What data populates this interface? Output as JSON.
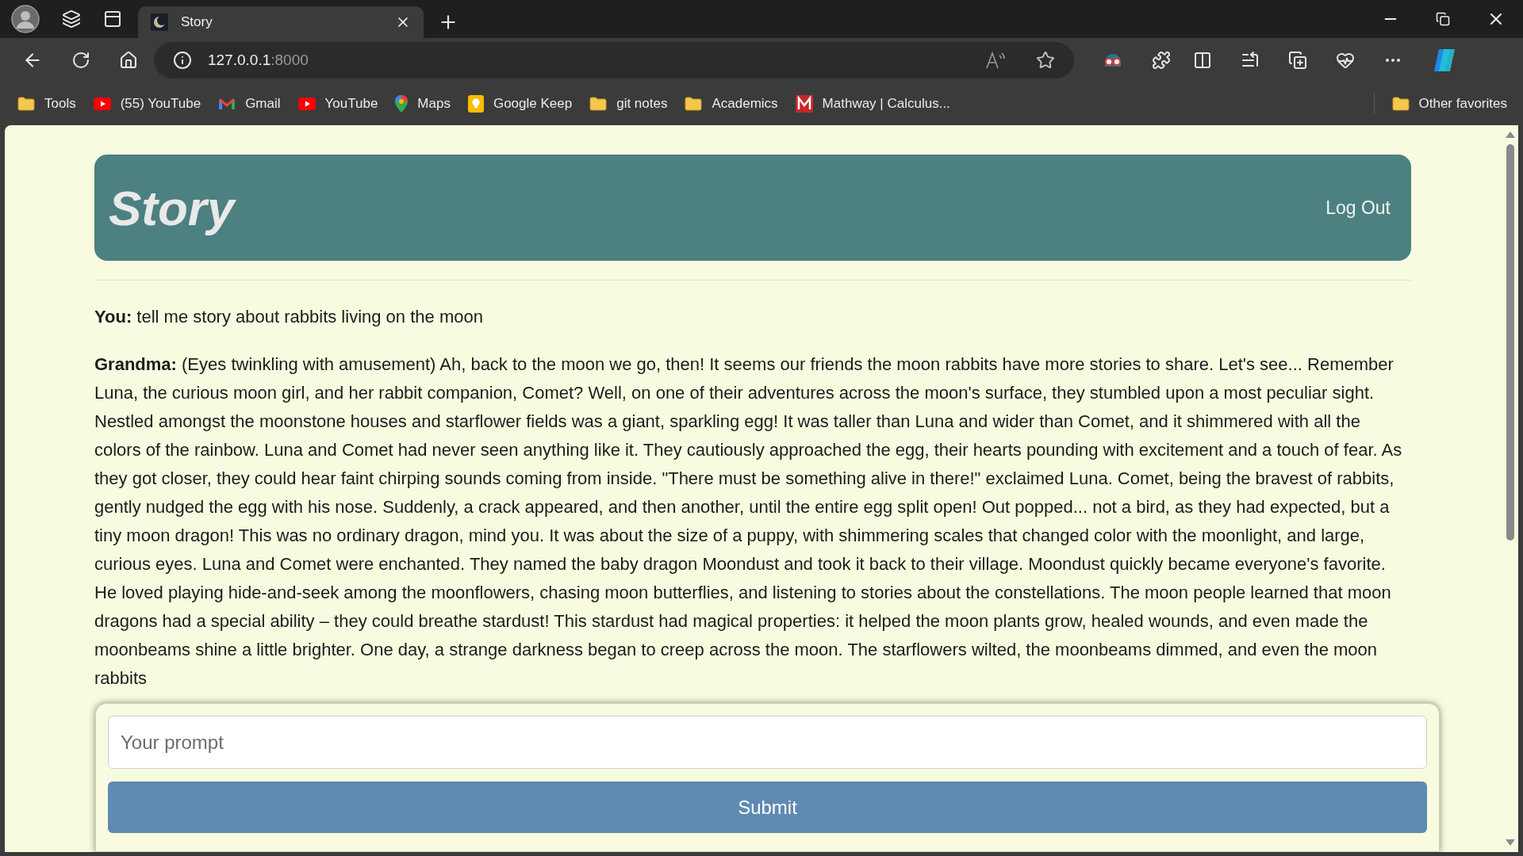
{
  "browser": {
    "tab_title": "Story",
    "address_host": "127.0.0.1",
    "address_port": ":8000",
    "bookmarks": [
      {
        "label": "Tools",
        "kind": "folder"
      },
      {
        "label": "(55) YouTube",
        "kind": "youtube"
      },
      {
        "label": "Gmail",
        "kind": "gmail"
      },
      {
        "label": "YouTube",
        "kind": "youtube"
      },
      {
        "label": "Maps",
        "kind": "maps"
      },
      {
        "label": "Google Keep",
        "kind": "keep"
      },
      {
        "label": "git notes",
        "kind": "folder"
      },
      {
        "label": "Academics",
        "kind": "folder"
      },
      {
        "label": "Mathway | Calculus...",
        "kind": "mathway"
      }
    ],
    "other_favorites": "Other favorites"
  },
  "page": {
    "title": "Story",
    "logout": "Log Out",
    "messages": [
      {
        "text": "**You:** tell me story about rabbits living on the moon"
      },
      {
        "text": "**Grandma:** (Eyes twinkling with amusement) Ah, back to the moon we go, then! It seems our friends the moon rabbits have more stories to share. Let's see... Remember Luna, the curious moon girl, and her rabbit companion, Comet? Well, on one of their adventures across the moon's surface, they stumbled upon a most peculiar sight. Nestled amongst the moonstone houses and starflower fields was a giant, sparkling egg! It was taller than Luna and wider than Comet, and it shimmered with all the colors of the rainbow. Luna and Comet had never seen anything like it. They cautiously approached the egg, their hearts pounding with excitement and a touch of fear. As they got closer, they could hear faint chirping sounds coming from inside. \"There must be something alive in there!\" exclaimed Luna. Comet, being the bravest of rabbits, gently nudged the egg with his nose. Suddenly, a crack appeared, and then another, until the entire egg split open! Out popped... not a bird, as they had expected, but a tiny moon dragon! This was no ordinary dragon, mind you. It was about the size of a puppy, with shimmering scales that changed color with the moonlight, and large, curious eyes. Luna and Comet were enchanted. They named the baby dragon Moondust and took it back to their village. Moondust quickly became everyone's favorite. He loved playing hide-and-seek among the moonflowers, chasing moon butterflies, and listening to stories about the constellations. The moon people learned that moon dragons had a special ability – they could breathe stardust! This stardust had magical properties: it helped the moon plants grow, healed wounds, and even made the moonbeams shine a little brighter. One day, a strange darkness began to creep across the moon. The starflowers wilted, the moonbeams dimmed, and even the moon rabbits"
      }
    ],
    "prompt_placeholder": "Your prompt",
    "submit": "Submit"
  }
}
